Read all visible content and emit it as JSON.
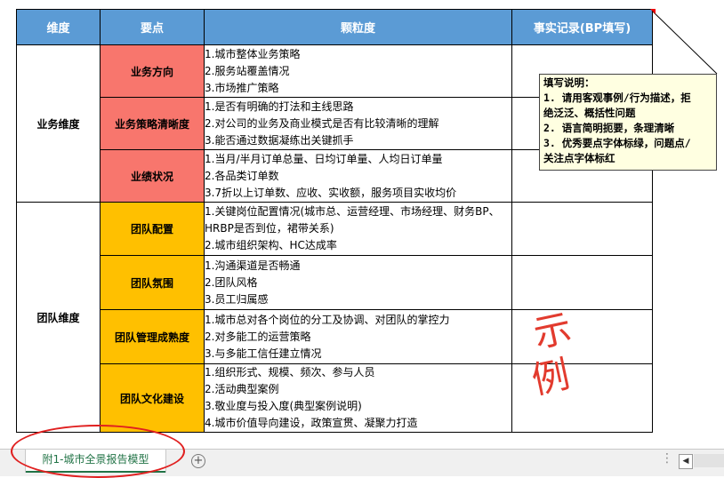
{
  "header": {
    "col_dimension": "维度",
    "col_key_point": "要点",
    "col_granularity": "颗粒度",
    "col_record": "事实记录(BP填写)"
  },
  "groups": [
    {
      "dimension": "业务维度",
      "rows": [
        {
          "key": "业务方向",
          "lines": [
            "1.城市整体业务策略",
            "2.服务站覆盖情况",
            "3.市场推广策略"
          ]
        },
        {
          "key": "业务策略清晰度",
          "lines": [
            "1.是否有明确的打法和主线思路",
            "2.对公司的业务及商业模式是否有比较清晰的理解",
            "3.能否通过数据凝练出关键抓手"
          ]
        },
        {
          "key": "业绩状况",
          "lines": [
            "1.当月/半月订单总量、日均订单量、人均日订单量",
            "2.各品类订单数",
            "3.7折以上订单数、应收、实收额，服务项目实收均价"
          ]
        }
      ]
    },
    {
      "dimension": "团队维度",
      "rows": [
        {
          "key": "团队配置",
          "lines": [
            "1.关键岗位配置情况(城市总、运营经理、市场经理、财务BP、HRBP是否到位，裙带关系)",
            "2.城市组织架构、HC达成率"
          ]
        },
        {
          "key": "团队氛围",
          "lines": [
            "1.沟通渠道是否畅通",
            "2.团队风格",
            "3.员工归属感"
          ]
        },
        {
          "key": "团队管理成熟度",
          "lines": [
            "1.城市总对各个岗位的分工及协调、对团队的掌控力",
            "2.对多能工的运营策略",
            "3.与多能工信任建立情况"
          ]
        },
        {
          "key": "团队文化建设",
          "lines": [
            "1.组织形式、规模、频次、参与人员",
            "2.活动典型案例",
            "3.敬业度与投入度(典型案例说明)",
            "4.城市价值导向建设，政策宣贯、凝聚力打造"
          ]
        }
      ]
    }
  ],
  "note": {
    "title": "填写说明：",
    "lines": [
      "1. 请用客观事例/行为描述，拒",
      "绝泛泛、概括性问题",
      "2. 语言简明扼要，条理清晰",
      "3. 优秀要点字体标绿，问题点/",
      "关注点字体标红"
    ]
  },
  "stamp": {
    "char1": "示",
    "char2": "例"
  },
  "sheet_tab": {
    "label": "附1-城市全景报告模型"
  },
  "tab_add_symbol": "+",
  "colors": {
    "header_blue": "#5b9bd5",
    "key_red": "#f8766d",
    "key_orange": "#ffc000",
    "note_bg": "#ffffe1",
    "sample_red": "#e23b2e",
    "tab_green": "#217346"
  }
}
